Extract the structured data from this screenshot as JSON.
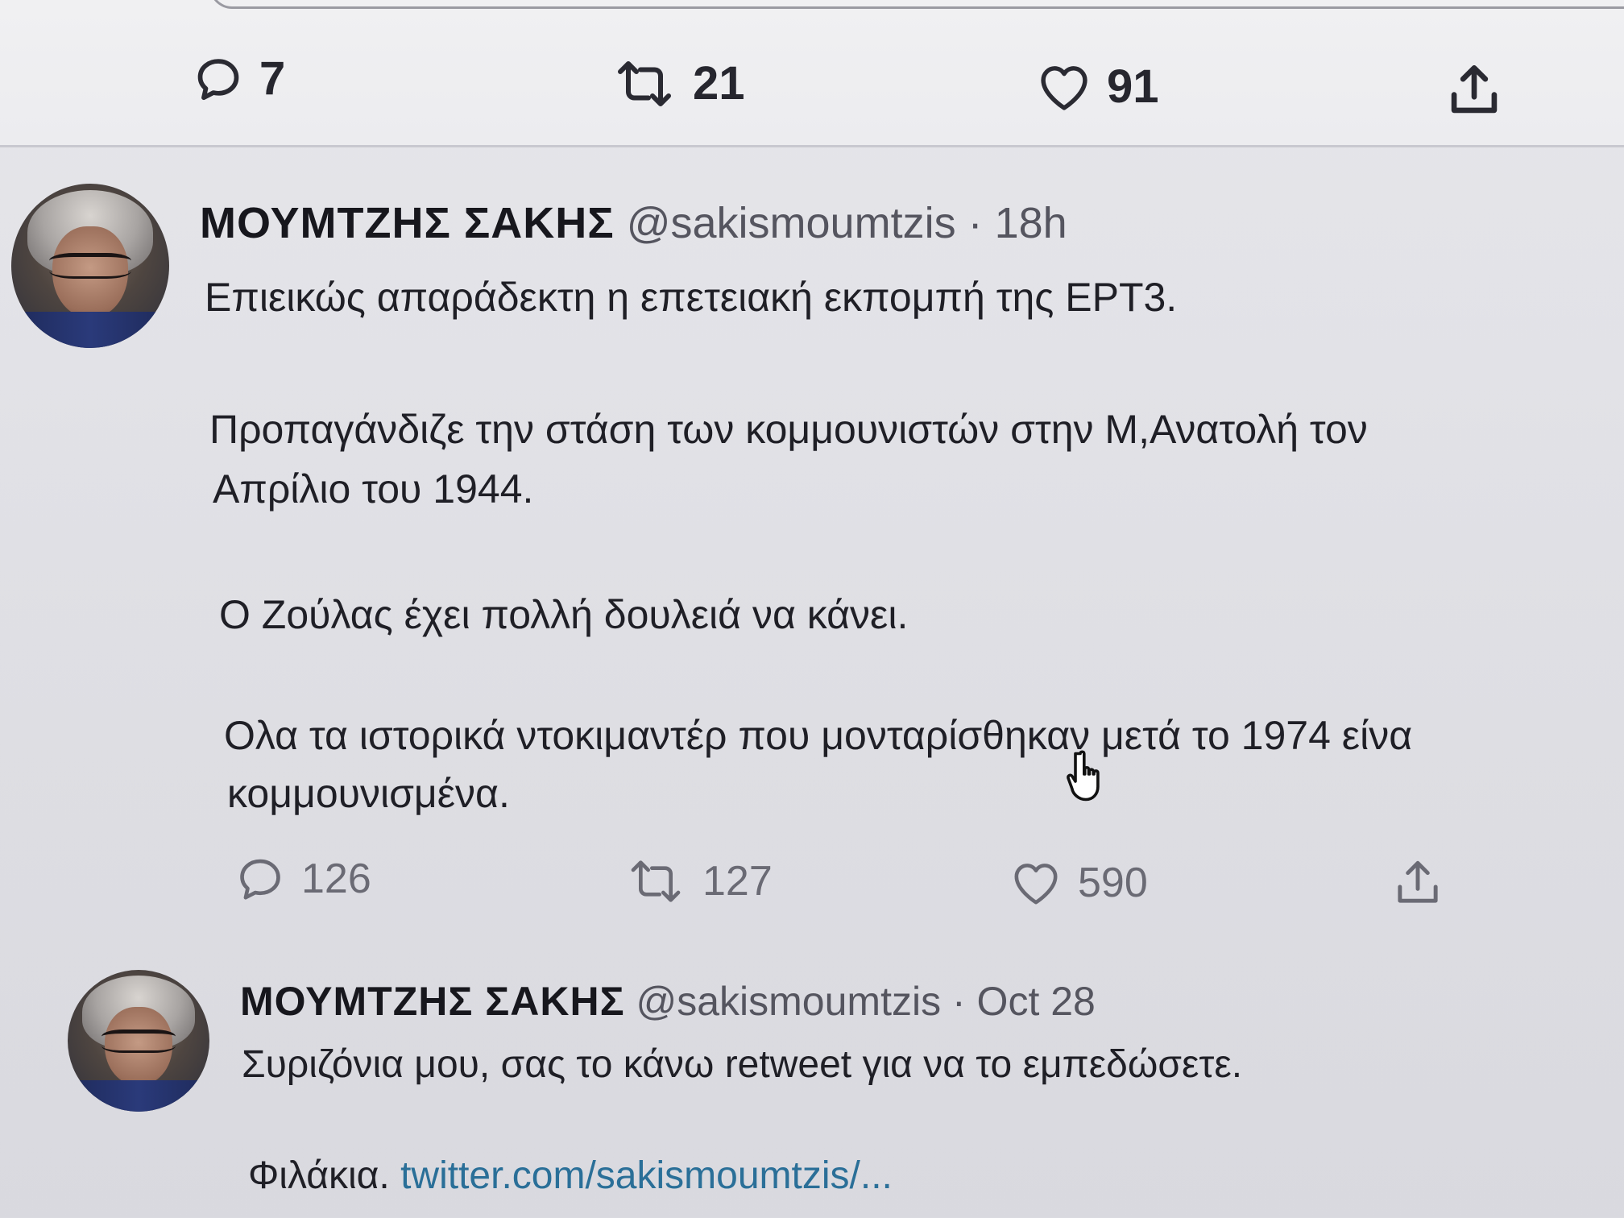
{
  "top_tweet_actions": {
    "replies": "7",
    "retweets": "21",
    "likes": "91"
  },
  "tweet_1": {
    "author_name": "ΜΟΥΜΤΖΗΣ ΣΑΚΗΣ",
    "handle": "@sakismoumtzis",
    "separator": "·",
    "time": "18h",
    "paragraphs": [
      "Επιεικώς απαράδεκτη η επετειακή εκπομπή της ΕΡΤ3.",
      "Προπαγάνδιζε την στάση των κομμουνιστών στην Μ,Ανατολή τον",
      "Απρίλιο του 1944.",
      "Ο Ζούλας έχει πολλή δουλειά να κάνει.",
      "Ολα τα ιστορικά ντοκιμαντέρ που μονταρίσθηκαν μετά το 1974 είνα",
      "κομμουνισμένα."
    ],
    "actions": {
      "replies": "126",
      "retweets": "127",
      "likes": "590"
    }
  },
  "tweet_2": {
    "author_name": "ΜΟΥΜΤΖΗΣ ΣΑΚΗΣ",
    "handle": "@sakismoumtzis",
    "separator": "·",
    "time": "Oct 28",
    "line_1": "Συριζόνια μου, σας το κάνω retweet για να το εμπεδώσετε.",
    "line_2_prefix": "Φιλάκια.",
    "link_text": "twitter.com/sakismoumtzis/..."
  },
  "icons": [
    "reply-icon",
    "retweet-icon",
    "like-icon",
    "share-icon",
    "hand-pointer-icon"
  ],
  "colors": {
    "link": "#2a6f98",
    "text": "#1f1f26",
    "muted": "#55555f"
  }
}
